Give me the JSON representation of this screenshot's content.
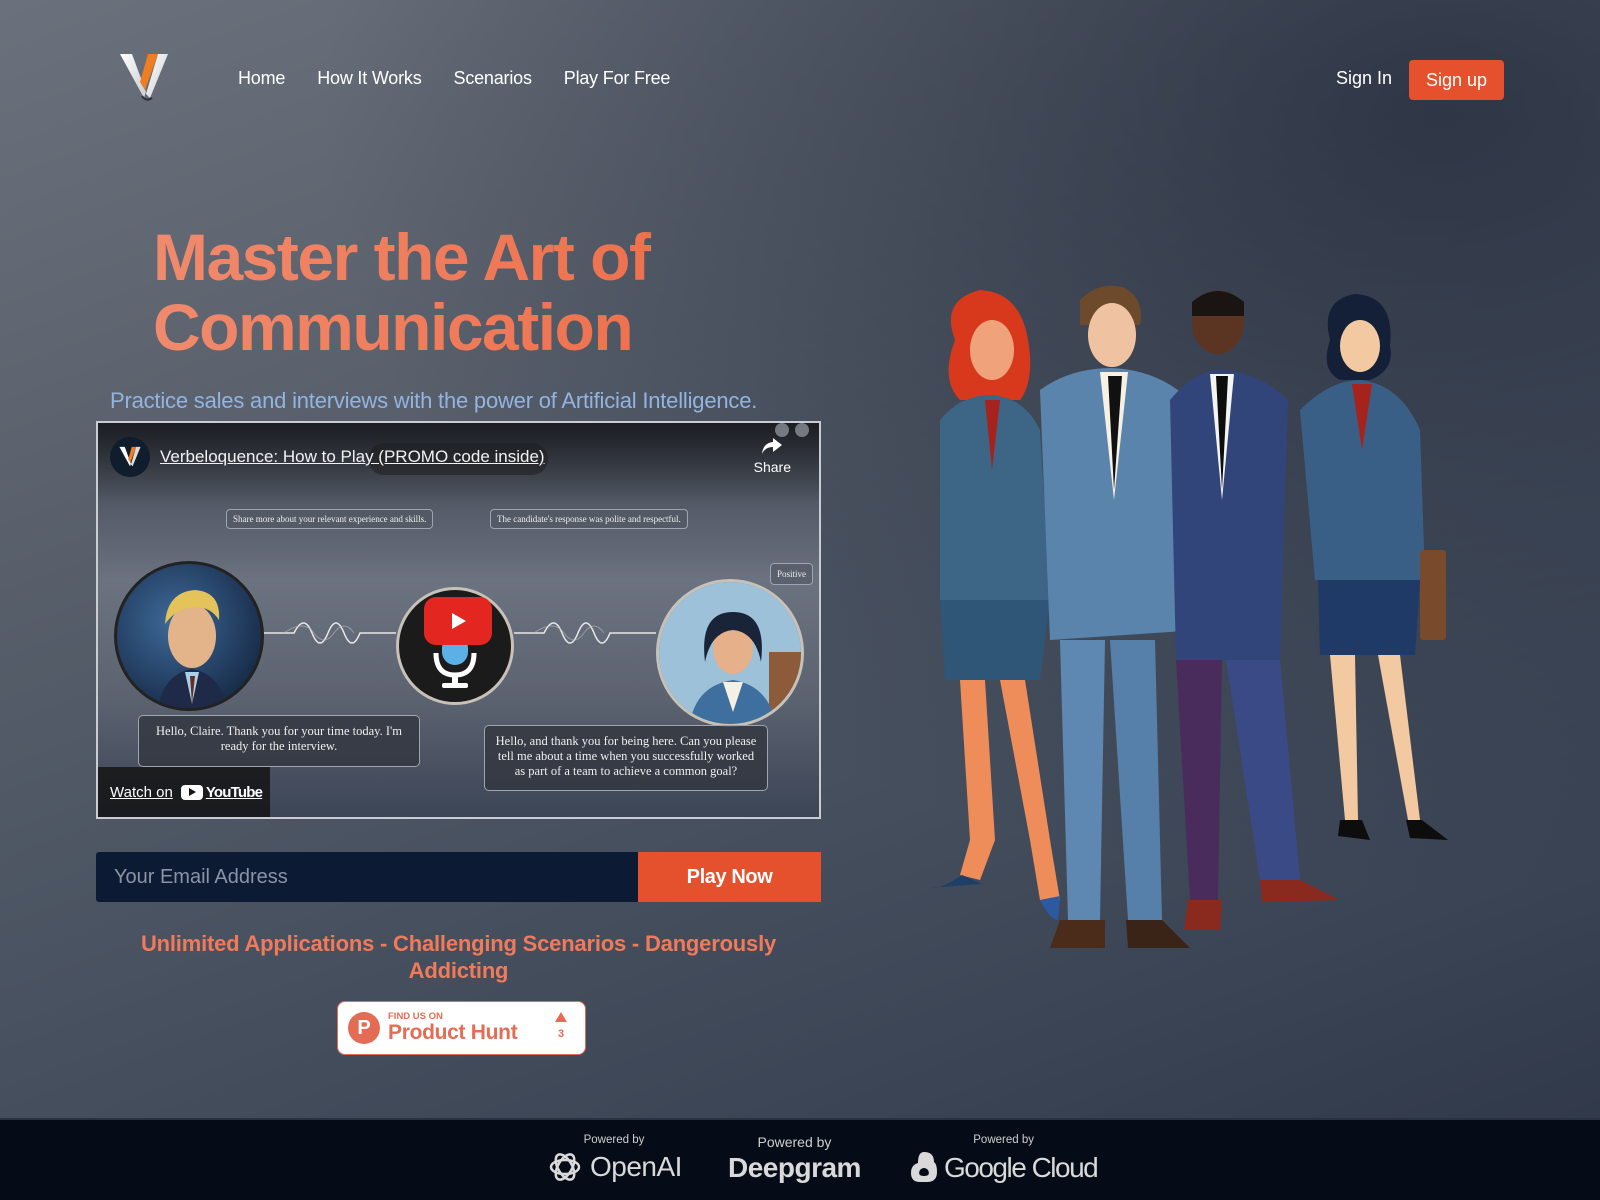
{
  "brand": {
    "name": "Verbeloquence",
    "logo_letter": "V",
    "accent_color": "#e5512c",
    "title_color": "#ee6a45",
    "subtitle_color": "#93b4e0"
  },
  "nav": {
    "items": [
      {
        "label": "Home"
      },
      {
        "label": "How It Works"
      },
      {
        "label": "Scenarios"
      },
      {
        "label": "Play For Free"
      }
    ],
    "sign_in": "Sign In",
    "sign_up": "Sign up"
  },
  "hero": {
    "title_line1": "Master the Art of",
    "title_line2": "Communication",
    "subtitle": "Practice sales and interviews with the power of Artificial Intelligence."
  },
  "video": {
    "title": "Verbeloquence: How to Play (PROMO code inside)",
    "share_label": "Share",
    "caption_left": "Share more about your relevant experience and skills.",
    "caption_right": "The candidate's response was polite and respectful.",
    "sentiment_tag": "Positive",
    "speech_left": "Hello, Claire. Thank you for your time today. I'm ready for the interview.",
    "speech_right": "Hello, and thank you for being here. Can you please tell me about a time when you successfully worked as part of a team to achieve a common goal?",
    "watch_on": "Watch on",
    "youtube_label": "YouTube"
  },
  "signup_form": {
    "email_placeholder": "Your Email Address",
    "email_value": "",
    "submit_label": "Play Now"
  },
  "tagline": "Unlimited Applications - Challenging Scenarios - Dangerously Addicting",
  "product_hunt": {
    "small_text": "FIND US ON",
    "big_text": "Product Hunt",
    "logo_letter": "P",
    "votes": "3"
  },
  "footer": {
    "partners": [
      {
        "powered_by": "Powered by",
        "name": "OpenAI"
      },
      {
        "powered_by": "Powered by",
        "name": "Deepgram"
      },
      {
        "powered_by": "Powered by",
        "name": "Google Cloud"
      }
    ]
  }
}
